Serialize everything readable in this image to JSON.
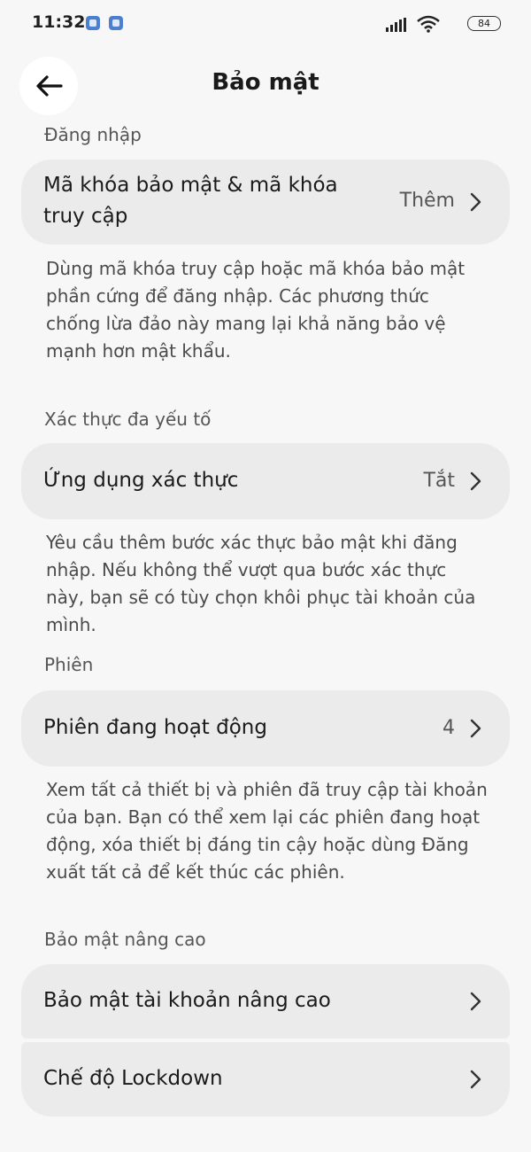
{
  "status_bar": {
    "time": "11:32",
    "battery": "84",
    "icons": [
      "notification-app-icon",
      "notification-app-icon",
      "signal-icon",
      "wifi-icon",
      "battery-icon"
    ]
  },
  "header": {
    "title": "Bảo mật",
    "back_icon": "arrow-left-icon"
  },
  "sections": [
    {
      "header": "Đăng nhập",
      "items": [
        {
          "label": "Mã khóa bảo mật & mã khóa truy cập",
          "value": "Thêm"
        }
      ],
      "description": "Dùng mã khóa truy cập hoặc mã khóa bảo mật phần cứng để đăng nhập. Các phương thức chống lừa đảo này mang lại khả năng bảo vệ mạnh hơn mật khẩu."
    },
    {
      "header": "Xác thực đa yếu tố",
      "items": [
        {
          "label": "Ứng dụng xác thực",
          "value": "Tắt"
        }
      ],
      "description": "Yêu cầu thêm bước xác thực bảo mật khi đăng nhập. Nếu không thể vượt qua bước xác thực này, bạn sẽ có tùy chọn khôi phục tài khoản của mình."
    },
    {
      "header": "Phiên",
      "items": [
        {
          "label": "Phiên đang hoạt động",
          "value": "4"
        }
      ],
      "description": "Xem tất cả thiết bị và phiên đã truy cập tài khoản của bạn. Bạn có thể xem lại các phiên đang hoạt động, xóa thiết bị đáng tin cậy hoặc dùng Đăng xuất tất cả để kết thúc các phiên."
    },
    {
      "header": "Bảo mật nâng cao",
      "items": [
        {
          "label": "Bảo mật tài khoản nâng cao",
          "value": ""
        },
        {
          "label": "Chế độ Lockdown",
          "value": ""
        }
      ]
    }
  ],
  "colors": {
    "background": "#f7f7f7",
    "card": "#ebebeb",
    "text": "#1a1a1a",
    "secondary_text": "#555555"
  }
}
